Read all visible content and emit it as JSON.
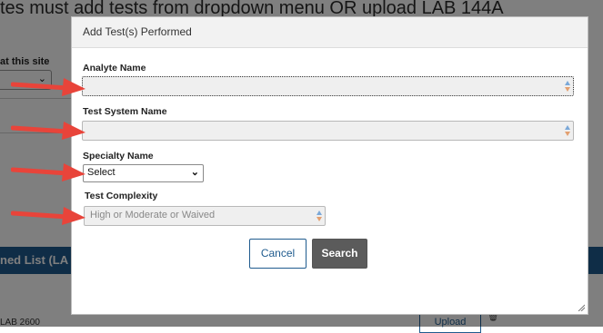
{
  "background": {
    "heading": "tes must add tests from dropdown menu OR upload LAB 144A",
    "site_label": "at this site",
    "bar_label": "ned List (LA",
    "lab_code": "LAB 2600",
    "upload_label": "Upload"
  },
  "modal": {
    "title": "Add Test(s) Performed",
    "analyte": {
      "label": "Analyte Name",
      "value": ""
    },
    "test_system": {
      "label": "Test System Name",
      "value": ""
    },
    "specialty": {
      "label": "Specialty Name",
      "selected": "Select"
    },
    "complexity": {
      "label": "Test Complexity",
      "placeholder": "High or Moderate or Waived"
    },
    "cancel_label": "Cancel",
    "search_label": "Search"
  },
  "colors": {
    "overlay": "#808080",
    "primary_blue": "#1f5b8e",
    "arrow_red": "#e8443a",
    "search_button": "#5b5b5b"
  },
  "icons": [
    "chevron-down-icon",
    "spinner-arrows-icon",
    "resize-handle-icon",
    "trash-icon",
    "red-arrow-icon"
  ]
}
